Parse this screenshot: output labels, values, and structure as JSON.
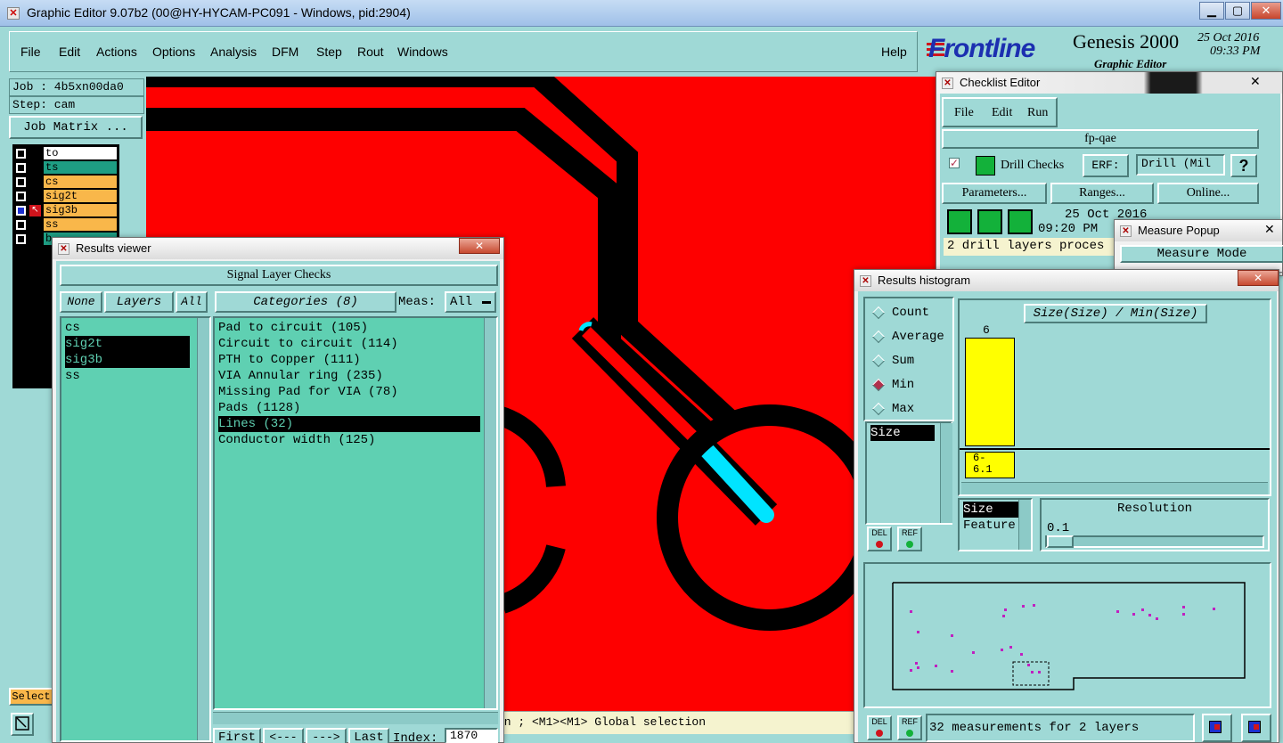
{
  "window": {
    "title": "Graphic Editor 9.07b2 (00@HY-HYCAM-PC091 - Windows, pid:2904)",
    "minimize": "▁",
    "maximize": "▢",
    "close": "✕"
  },
  "menu": {
    "file": "File",
    "edit": "Edit",
    "actions": "Actions",
    "options": "Options",
    "analysis": "Analysis",
    "dfm": "DFM",
    "step": "Step",
    "rout": "Rout",
    "windows": "Windows",
    "help": "Help"
  },
  "brand": {
    "logo": "Frontline",
    "product": "Genesis 2000",
    "subtitle": "Graphic Editor",
    "date": "25 Oct 2016",
    "time": "09:33 PM"
  },
  "left": {
    "job": "Job : 4b5xn00da0",
    "step": "Step: cam",
    "job_matrix": "Job Matrix ...",
    "layers": [
      {
        "name": "to",
        "color": "#ffffff"
      },
      {
        "name": "ts",
        "color": "#1e9d83"
      },
      {
        "name": "cs",
        "color": "#f9b74a"
      },
      {
        "name": "sig2t",
        "color": "#f9b74a"
      },
      {
        "name": "sig3b",
        "color": "#f9b74a"
      },
      {
        "name": "ss",
        "color": "#f9b74a"
      },
      {
        "name": "b",
        "color": "#1e9d83"
      }
    ],
    "select": "Select"
  },
  "status_line": "on ; <M1><M1> Global selection",
  "results_viewer": {
    "title": "Results viewer",
    "close": "✕",
    "header": "Signal Layer Checks",
    "none_btn": "None",
    "layers_btn": "Layers",
    "all_btn": "All",
    "categories_btn": "Categories (8)",
    "meas_label": "Meas:",
    "meas_value": "All",
    "layer_items": [
      "cs",
      "sig2t",
      "sig3b",
      "ss"
    ],
    "categories": [
      "Pad to circuit (105)",
      "Circuit to circuit (114)",
      "PTH to Copper (111)",
      "VIA Annular ring (235)",
      "Missing Pad for VIA (78)",
      "Pads (1128)",
      "Lines (32)",
      "Conductor width (125)"
    ],
    "nav": {
      "first": "First",
      "prev": "<---",
      "next": "--->",
      "last": "Last",
      "index_label": "Index:",
      "index_value": "1870"
    }
  },
  "checklist": {
    "title": "Checklist Editor",
    "close": "✕",
    "menu": {
      "file": "File",
      "edit": "Edit",
      "run": "Run"
    },
    "name": "fp-qae",
    "check": "Drill Checks",
    "erf_label": "ERF:",
    "erf_value": "Drill (Mil",
    "help": "?",
    "parameters": "Parameters...",
    "ranges": "Ranges...",
    "online": "Online...",
    "run_date": "25 Oct 2016",
    "run_time": "09:20 PM",
    "message": "2 drill layers proces"
  },
  "measure": {
    "title": "Measure Popup",
    "close": "✕",
    "mode": "Measure Mode"
  },
  "histogram": {
    "title": "Results histogram",
    "close": "✕",
    "modes": [
      "Count",
      "Average",
      "Sum",
      "Min",
      "Max"
    ],
    "active_mode": "Min",
    "list_item": "Size",
    "chart_title": "Size(Size) / Min(Size)",
    "bar_label": "6",
    "bin_label": "6-\n6.1",
    "sort_items": [
      "Size",
      "Feature"
    ],
    "resolution_label": "Resolution",
    "resolution_value": "0.1",
    "del": "DEL",
    "ref": "REF",
    "summary": "32 measurements for 2 layers",
    "bar_fraction": 1.0,
    "colors": {
      "bar": "#ffff00",
      "points": "#c020c0"
    }
  }
}
